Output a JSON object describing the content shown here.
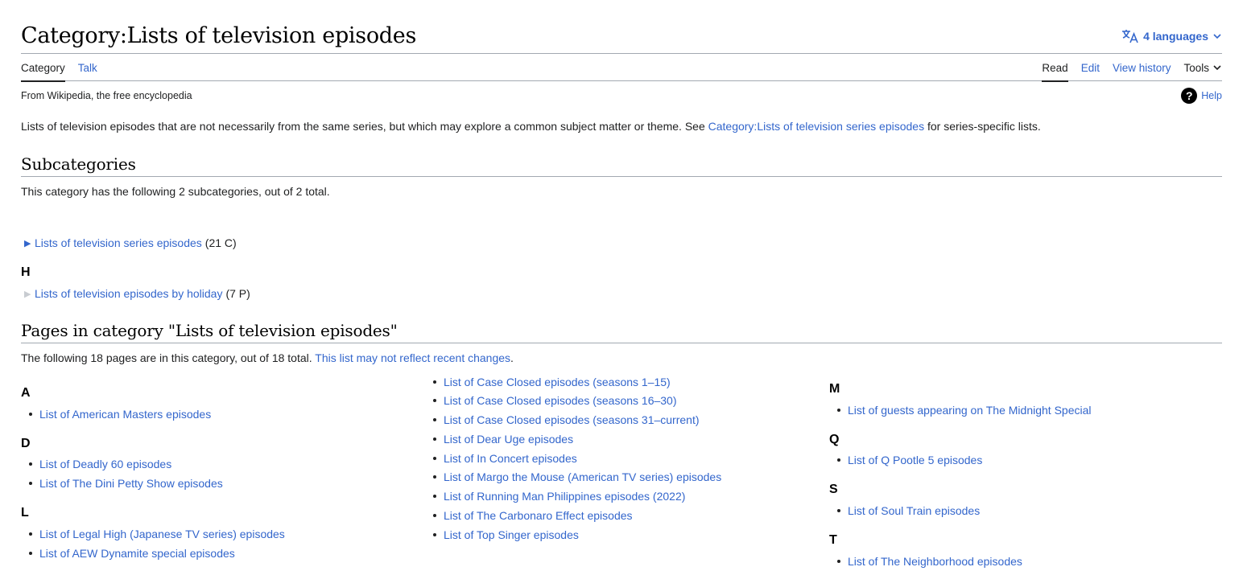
{
  "header": {
    "title": "Category:Lists of television episodes",
    "languages_label": "4 languages"
  },
  "tabs": {
    "left": [
      {
        "label": "Category",
        "selected": true
      },
      {
        "label": "Talk",
        "selected": false
      }
    ],
    "right": [
      {
        "label": "Read",
        "selected": true
      },
      {
        "label": "Edit",
        "selected": false
      },
      {
        "label": "View history",
        "selected": false
      }
    ],
    "tools_label": "Tools"
  },
  "tagline": "From Wikipedia, the free encyclopedia",
  "help_label": "Help",
  "intro": {
    "before": "Lists of television episodes that are not necessarily from the same series, but which may explore a common subject matter or theme. See ",
    "link": "Category:Lists of television series episodes",
    "after": " for series-specific lists."
  },
  "subcategories": {
    "heading": "Subcategories",
    "summary": "This category has the following 2 subcategories, out of 2 total.",
    "groups": [
      {
        "letter": "",
        "items": [
          {
            "label": "Lists of television series episodes",
            "count": "(21 C)",
            "expandable": true
          }
        ]
      },
      {
        "letter": "H",
        "items": [
          {
            "label": "Lists of television episodes by holiday",
            "count": "(7 P)",
            "expandable": false
          }
        ]
      }
    ]
  },
  "pages": {
    "heading": "Pages in category \"Lists of television episodes\"",
    "summary": "The following 18 pages are in this category, out of 18 total. ",
    "summary_link": "This list may not reflect recent changes",
    "summary_end": ".",
    "columns": [
      {
        "groups": [
          {
            "letter": "A",
            "items": [
              "List of American Masters episodes"
            ]
          },
          {
            "letter": "D",
            "items": [
              "List of Deadly 60 episodes",
              "List of The Dini Petty Show episodes"
            ]
          },
          {
            "letter": "L",
            "items": [
              "List of Legal High (Japanese TV series) episodes",
              "List of AEW Dynamite special episodes"
            ]
          }
        ]
      },
      {
        "groups": [
          {
            "letter": "",
            "items": [
              "List of Case Closed episodes (seasons 1–15)",
              "List of Case Closed episodes (seasons 16–30)",
              "List of Case Closed episodes (seasons 31–current)",
              "List of Dear Uge episodes",
              "List of In Concert episodes",
              "List of Margo the Mouse (American TV series) episodes",
              "List of Running Man Philippines episodes (2022)",
              "List of The Carbonaro Effect episodes",
              "List of Top Singer episodes"
            ]
          }
        ]
      },
      {
        "groups": [
          {
            "letter": "M",
            "items": [
              "List of guests appearing on The Midnight Special"
            ]
          },
          {
            "letter": "Q",
            "items": [
              "List of Q Pootle 5 episodes"
            ]
          },
          {
            "letter": "S",
            "items": [
              "List of Soul Train episodes"
            ]
          },
          {
            "letter": "T",
            "items": [
              "List of The Neighborhood episodes"
            ]
          }
        ]
      }
    ]
  },
  "colors": {
    "link": "#3366cc",
    "text": "#202122",
    "border": "#a2a9b1"
  }
}
